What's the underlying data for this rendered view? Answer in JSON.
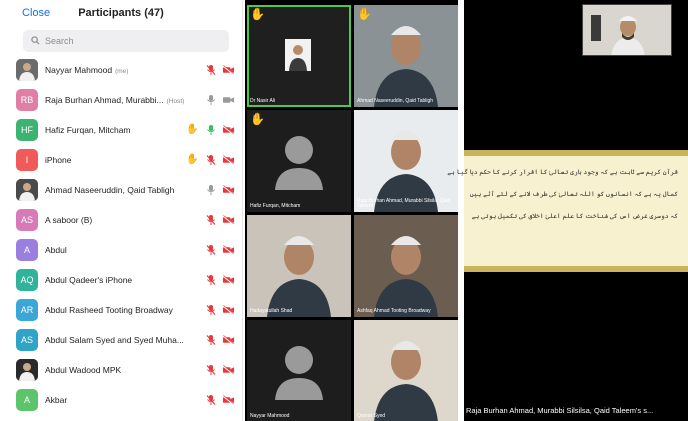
{
  "participants_panel": {
    "close_label": "Close",
    "title": "Participants (47)",
    "search_placeholder": "Search",
    "items": [
      {
        "name": "Nayyar Mahmood",
        "tag": "(me)",
        "avatar_text": "",
        "avatar_color": "#6b6b6b",
        "photo": true,
        "hand": false,
        "mic": "muted",
        "video": "off"
      },
      {
        "name": "Raja Burhan Ahmad, Murabbi...",
        "tag": "(Host)",
        "avatar_text": "RB",
        "avatar_color": "#e07fa6",
        "photo": false,
        "hand": false,
        "mic": "on-grey",
        "video": "on-grey"
      },
      {
        "name": "Hafiz Furqan, Mitcham",
        "tag": "",
        "avatar_text": "HF",
        "avatar_color": "#3cb371",
        "photo": false,
        "hand": true,
        "mic": "on-green",
        "video": "off"
      },
      {
        "name": "iPhone",
        "tag": "",
        "avatar_text": "I",
        "avatar_color": "#f05a5a",
        "photo": false,
        "hand": true,
        "mic": "muted",
        "video": "off"
      },
      {
        "name": "Ahmad Naseeruddin, Qaid Tabligh",
        "tag": "",
        "avatar_text": "",
        "avatar_color": "#4a4a4a",
        "photo": true,
        "hand": false,
        "mic": "on-grey",
        "video": "off"
      },
      {
        "name": "A saboor (B)",
        "tag": "",
        "avatar_text": "AS",
        "avatar_color": "#d97ab8",
        "photo": false,
        "hand": false,
        "mic": "muted",
        "video": "off"
      },
      {
        "name": "Abdul",
        "tag": "",
        "avatar_text": "A",
        "avatar_color": "#9b7fe0",
        "photo": false,
        "hand": false,
        "mic": "muted",
        "video": "off"
      },
      {
        "name": "Abdul Qadeer's iPhone",
        "tag": "",
        "avatar_text": "AQ",
        "avatar_color": "#2fb39a",
        "photo": false,
        "hand": false,
        "mic": "muted",
        "video": "off"
      },
      {
        "name": "Abdul Rasheed Tooting Broadway",
        "tag": "",
        "avatar_text": "AR",
        "avatar_color": "#3aa7d8",
        "photo": false,
        "hand": false,
        "mic": "muted",
        "video": "off"
      },
      {
        "name": "Abdul Salam Syed and Syed Muha...",
        "tag": "",
        "avatar_text": "AS",
        "avatar_color": "#2fa3c8",
        "photo": false,
        "hand": false,
        "mic": "muted",
        "video": "off"
      },
      {
        "name": "Abdul Wadood MPK",
        "tag": "",
        "avatar_text": "",
        "avatar_color": "#2a2a2a",
        "photo": true,
        "hand": false,
        "mic": "muted",
        "video": "off"
      },
      {
        "name": "Akbar",
        "tag": "",
        "avatar_text": "A",
        "avatar_color": "#5cc46a",
        "photo": false,
        "hand": false,
        "mic": "muted",
        "video": "off"
      }
    ]
  },
  "gallery": {
    "tiles": [
      {
        "name": "Dr Nasir Ali",
        "hand": true,
        "active": true,
        "kind": "card",
        "bg": "#1f1f1f"
      },
      {
        "name": "Ahmad Naseeruddin, Qaid Tabligh",
        "hand": true,
        "active": false,
        "kind": "person",
        "bg": "#8a9296"
      },
      {
        "name": "Hafiz Furqan, Mitcham",
        "hand": true,
        "active": false,
        "kind": "placeholder",
        "bg": "#1d1d1d"
      },
      {
        "name": "Raja Burhan Ahmad, Murabbi Silsila, Qaid Taleem",
        "hand": false,
        "active": false,
        "kind": "person",
        "bg": "#e9ecef"
      },
      {
        "name": "Hadayatullah Shad",
        "hand": false,
        "active": false,
        "kind": "person",
        "bg": "#c9c3ba"
      },
      {
        "name": "Ashfaq Ahmad Tooting Broadway",
        "hand": false,
        "active": false,
        "kind": "person",
        "bg": "#6b5d50"
      },
      {
        "name": "Nayyar Mahmood",
        "hand": false,
        "active": false,
        "kind": "placeholder",
        "bg": "#1d1d1d"
      },
      {
        "name": "Qamar Syed",
        "hand": false,
        "active": false,
        "kind": "person",
        "bg": "#ddd7cc"
      }
    ]
  },
  "speaker": {
    "name_label": "Raja Burhan Ahmad, Murabbi Silsilsa, Qaid Taleem's s...",
    "slide_lines": [
      "قرآن کریم سے ثابت ہے کہ وجود باری تعالیٰ کا اقرار کرنے کا حکم دیا گیا ہے",
      "کمال یہ ہے کہ انسانوں کو اللہ تعالیٰ کی طرف لانے کے لئے آئے ہیں",
      "کہ دوسری غرض اس کی شناخت کا علم اعلیٰ اخلاق کی تکمیل ہوتی ہے"
    ]
  }
}
